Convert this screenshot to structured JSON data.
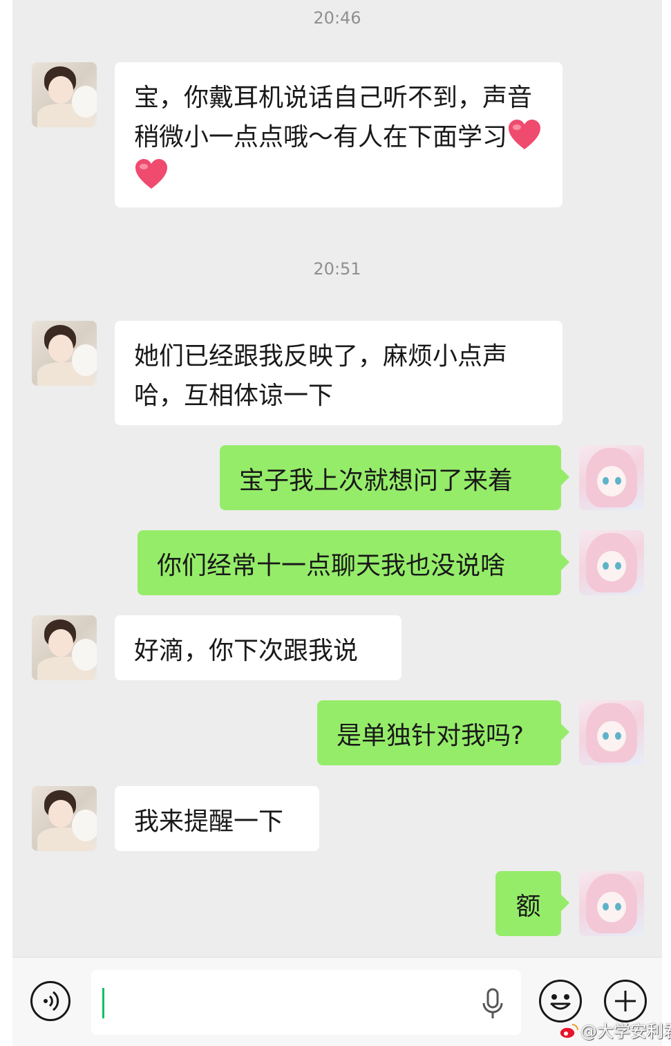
{
  "timestamps": [
    "20:46",
    "20:51"
  ],
  "messages": [
    {
      "side": "in",
      "text": "宝，你戴耳机说话自己听不到，声音稍微小一点点哦～有人在下面学习",
      "emoji": "❤️❤️"
    },
    {
      "side": "in",
      "text": "她们已经跟我反映了，麻烦小点声哈，互相体谅一下"
    },
    {
      "side": "out",
      "text": "宝子我上次就想问了来着"
    },
    {
      "side": "out",
      "text": "你们经常十一点聊天我也没说啥"
    },
    {
      "side": "in",
      "text": "好滴，你下次跟我说"
    },
    {
      "side": "out",
      "text": "是单独针对我吗?"
    },
    {
      "side": "in",
      "text": "我来提醒一下"
    },
    {
      "side": "out",
      "text": "额"
    }
  ],
  "input_bar": {
    "voice_icon": "voice-wave-icon",
    "mic_icon": "microphone-icon",
    "emoji_icon": "smiley-icon",
    "plus_icon": "plus-icon",
    "input_value": ""
  },
  "watermark": {
    "logo": "weibo-logo",
    "text": "@大学安利君"
  },
  "colors": {
    "chat_bg": "#ededed",
    "incoming_bubble": "#ffffff",
    "outgoing_bubble": "#95ec69",
    "caret": "#07c160"
  }
}
